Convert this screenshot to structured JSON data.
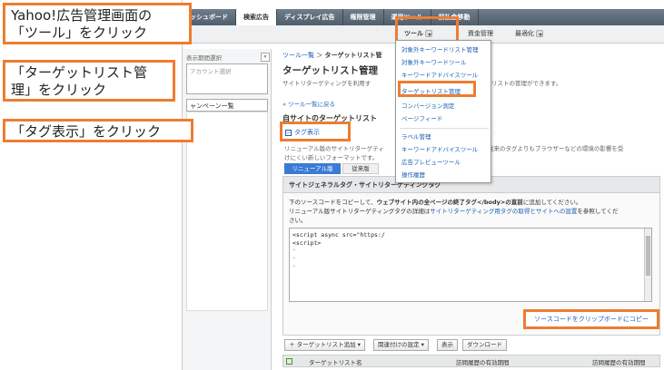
{
  "callouts": {
    "step1_line1": "Yahoo!広告管理画面の",
    "step1_line2": "「ツール」をクリック",
    "step2_line1": "「ターゲットリスト管",
    "step2_line2": "理」をクリック",
    "step3": "「タグ表示」をクリック"
  },
  "topnav": {
    "tabs": [
      "ッシュボード",
      "検索広告",
      "ディスプレイ広告",
      "権限管理",
      "運用ツール",
      "前払金移動"
    ],
    "active_index": 1
  },
  "subnav": {
    "tools_label": "ツール",
    "funds_label": "資金管理",
    "optimize_label": "最適化"
  },
  "sidebar": {
    "label": "表示期間選択",
    "collapse": "«",
    "account_placeholder": "アカウント選択",
    "campaign_list": "ャンペーン一覧"
  },
  "main": {
    "breadcrumb_link": "ツール一覧",
    "breadcrumb_sep": " ＞ ",
    "breadcrumb_current": "ターゲットリスト管",
    "title": "ターゲットリスト管理",
    "desc_left": "サイトリターゲティングを利用す",
    "desc_right": "リストの管理ができます。",
    "back_link": "« ツール一覧に戻る",
    "section_title": "自サイトのターゲットリスト",
    "tag_toggle": "タグ表示",
    "tag_desc_left": "リニューアル版のサイトリターゲティ",
    "tag_desc_right": "従来のタグよりもブラウザーなどの環境の影響を受",
    "tag_desc_line2": "けにくい新しいフォーマットです。",
    "version_renewal": "リニューアル版",
    "version_old": "従来版",
    "tag_box_title": "サイトジェネラルタグ・サイトリターゲティングタグ",
    "copy_inst_pre": "下のソースコードをコピーして、",
    "copy_inst_bold": "ウェブサイト内の全ページの終了タグ</body>の直前",
    "copy_inst_post": "に追加してください。",
    "copy_inst2_pre": "リニューアル版サイトリターゲティングタグの詳細は",
    "copy_inst2_link": "サイトリターゲティング用タグの取得とサイトへの設置",
    "copy_inst2_post": "を参照してくだ",
    "copy_inst3": "さい。",
    "code_lines": [
      "<script async src=\"https:/",
      "<script>",
      "",
      "",
      "",
      ""
    ],
    "copy_button": "ソースコードをクリップボードにコピー"
  },
  "toolbar": {
    "add_target": "ターゲットリスト追加",
    "link_settings": "関連付けの設定",
    "display": "表示",
    "download": "ダウンロード"
  },
  "table": {
    "col1": "ターゲットリスト名",
    "col2": "訪問履歴の有効期間",
    "col3": "訪問履歴の有効期間"
  },
  "tools_menu": {
    "items": [
      "対象外キーワードリスト管理",
      "対象外キーワードツール",
      "キーワードアドバイスツール",
      "ターゲットリスト管理",
      "コンバージョン測定",
      "ページフィード",
      "ラベル管理",
      "キーワードアドバイスツール",
      "広告プレビューツール",
      "操作履歴"
    ]
  },
  "colors": {
    "highlight": "#ed7d31",
    "link": "#1a5fb4",
    "nav": "#5b6a78"
  }
}
